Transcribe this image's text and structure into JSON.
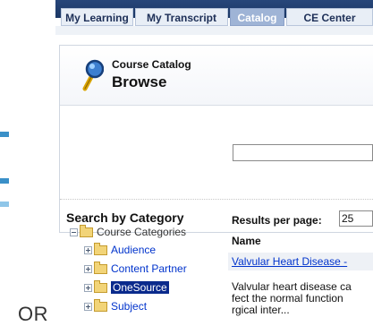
{
  "separator_text": "OR",
  "tabs": [
    {
      "label": "My Learning",
      "active": false
    },
    {
      "label": "My Transcript",
      "active": false
    },
    {
      "label": "Catalog",
      "active": true
    },
    {
      "label": "CE Center",
      "active": false
    }
  ],
  "header": {
    "title_small": "Course Catalog",
    "title_large": "Browse"
  },
  "search": {
    "value": "",
    "placeholder": ""
  },
  "sidebar": {
    "heading": "Search by Category",
    "root": "Course Categories",
    "items": [
      {
        "label": "Audience",
        "selected": false
      },
      {
        "label": "Content Partner",
        "selected": false
      },
      {
        "label": "OneSource",
        "selected": true
      },
      {
        "label": "Subject",
        "selected": false
      }
    ]
  },
  "results": {
    "per_page_label": "Results per page:",
    "per_page_value": "25",
    "column_name": "Name",
    "first_title": "Valvular Heart Disease -",
    "first_description": [
      "Valvular heart disease ca",
      "fect the normal function",
      "rgical inter..."
    ]
  },
  "colors": {
    "nav_bar": "#1b3764",
    "active_tab": "#9fb4d6",
    "link": "#0033cc",
    "selection": "#0a2a8c"
  }
}
